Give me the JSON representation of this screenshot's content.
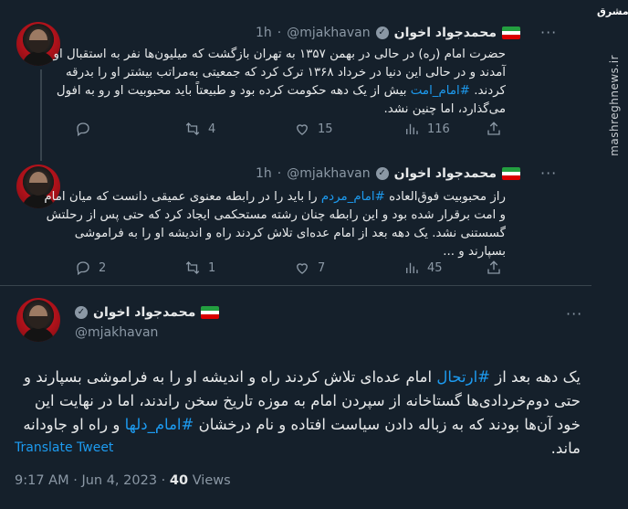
{
  "watermark": {
    "logo": "مشرق",
    "site": "mashreghnews.ir"
  },
  "tweets": [
    {
      "name": "محمدجواد اخوان",
      "handle": "@mjakhavan",
      "dot": "·",
      "time": "1h",
      "more": "···",
      "text_before": "حضرت امام (ره) در حالی در بهمن ۱۳۵۷ به تهران بازگشت که میلیون‌ها نفر به استقبال او آمدند و در حالی این دنیا در خرداد ۱۳۶۸ ترک کرد که جمعیتی به‌مراتب بیشتر او را بدرقه کردند. ",
      "hashtag": "#امام_امت",
      "text_after": " بیش از یک دهه حکومت کرده بود و طبیعتاً باید محبوبیت او رو به افول می‌گذارد، اما چنین نشد.",
      "replies": "",
      "retweets": "4",
      "likes": "15",
      "views": "116"
    },
    {
      "name": "محمدجواد اخوان",
      "handle": "@mjakhavan",
      "dot": "·",
      "time": "1h",
      "more": "···",
      "text_before": "راز محبوبیت فوق‌العاده ",
      "hashtag": "#امام_مردم",
      "text_after": " را باید را در رابطه معنوی عمیقی دانست که میان امام و امت برقرار شده بود و این رابطه چنان رشته مستحکمی ایجاد کرد که حتی پس از رحلتش گسستنی نشد. یک دهه بعد از امام عده‌ای تلاش کردند راه و اندیشه او را به فراموشی بسپارند و ...",
      "replies": "2",
      "retweets": "1",
      "likes": "7",
      "views": "45"
    }
  ],
  "main": {
    "name": "محمدجواد اخوان",
    "handle": "@mjakhavan",
    "more": "···",
    "t1": "یک دهه بعد از ",
    "h1": "#ارتحال",
    "t2": " امام عده‌ای تلاش کردند راه و اندیشه او را به فراموشی بسپارند و حتی دوم‌خردادی‌ها گستاخانه از سپردن امام به موزه تاریخ سخن راندند، اما در نهایت این خود آن‌ها بودند که به زباله دادن سیاست افتاده و نام درخشان ",
    "h2": "#امام_دلها",
    "t3": " و راه او جاودانه ماند.",
    "translate": "Translate Tweet",
    "time": "9:17 AM",
    "date": "Jun 4, 2023",
    "views_count": "40",
    "views_label": "Views",
    "dot": "·"
  },
  "colors": {
    "background": "#15202b",
    "accent": "#1d9bf0",
    "muted": "#8b98a5",
    "text": "#e7e9ea"
  }
}
